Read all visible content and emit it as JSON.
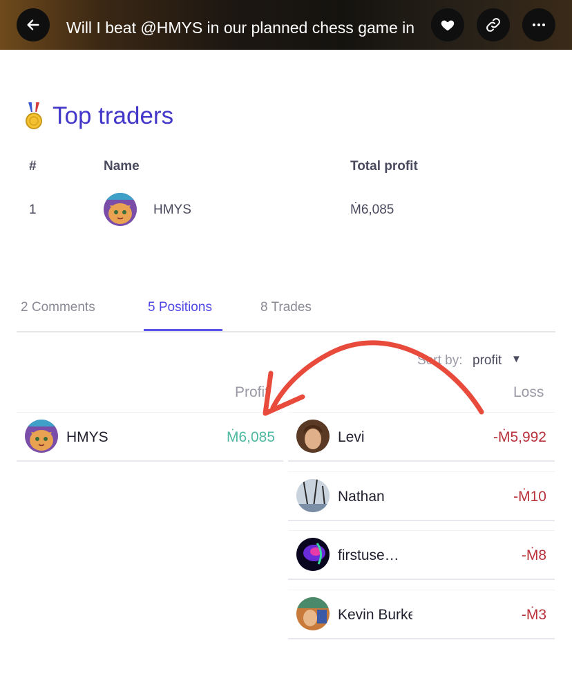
{
  "header": {
    "title": "Will I beat @HMYS in our planned chess game in August?",
    "background_colors": [
      "#6e4a1c",
      "#15130f",
      "#3a2a18"
    ],
    "icons": [
      "arrow-left-icon",
      "heart-icon",
      "link-icon",
      "more-horizontal-icon"
    ]
  },
  "top_traders": {
    "title": "Top traders",
    "icon": "medal-icon",
    "accent": "#4337c9",
    "columns": [
      "#",
      "Name",
      "Total profit"
    ],
    "rows": [
      {
        "rank": "1",
        "name": "HMYS",
        "profit": "Ṁ6,085"
      }
    ]
  },
  "tabs": [
    {
      "label": "2 Comments",
      "active": false
    },
    {
      "label": "5 Positions",
      "active": true
    },
    {
      "label": "8 Trades",
      "active": false
    }
  ],
  "sort": {
    "label": "Sort by:",
    "value": "profit"
  },
  "positions": {
    "profit_header": "Profit",
    "loss_header": "Loss",
    "profit": [
      {
        "name": "HMYS",
        "value": "Ṁ6,085"
      }
    ],
    "loss": [
      {
        "name": "Levi",
        "value": "-Ṁ5,992"
      },
      {
        "name": "Nathan",
        "value": "-Ṁ10"
      },
      {
        "name": "firstuse…",
        "value": "-Ṁ8"
      },
      {
        "name": "Kevin Burke",
        "value": "-Ṁ3"
      }
    ],
    "colors": {
      "profit": "#4fb8a0",
      "loss": "#b8313a",
      "arrow": "#e84a3c"
    }
  }
}
